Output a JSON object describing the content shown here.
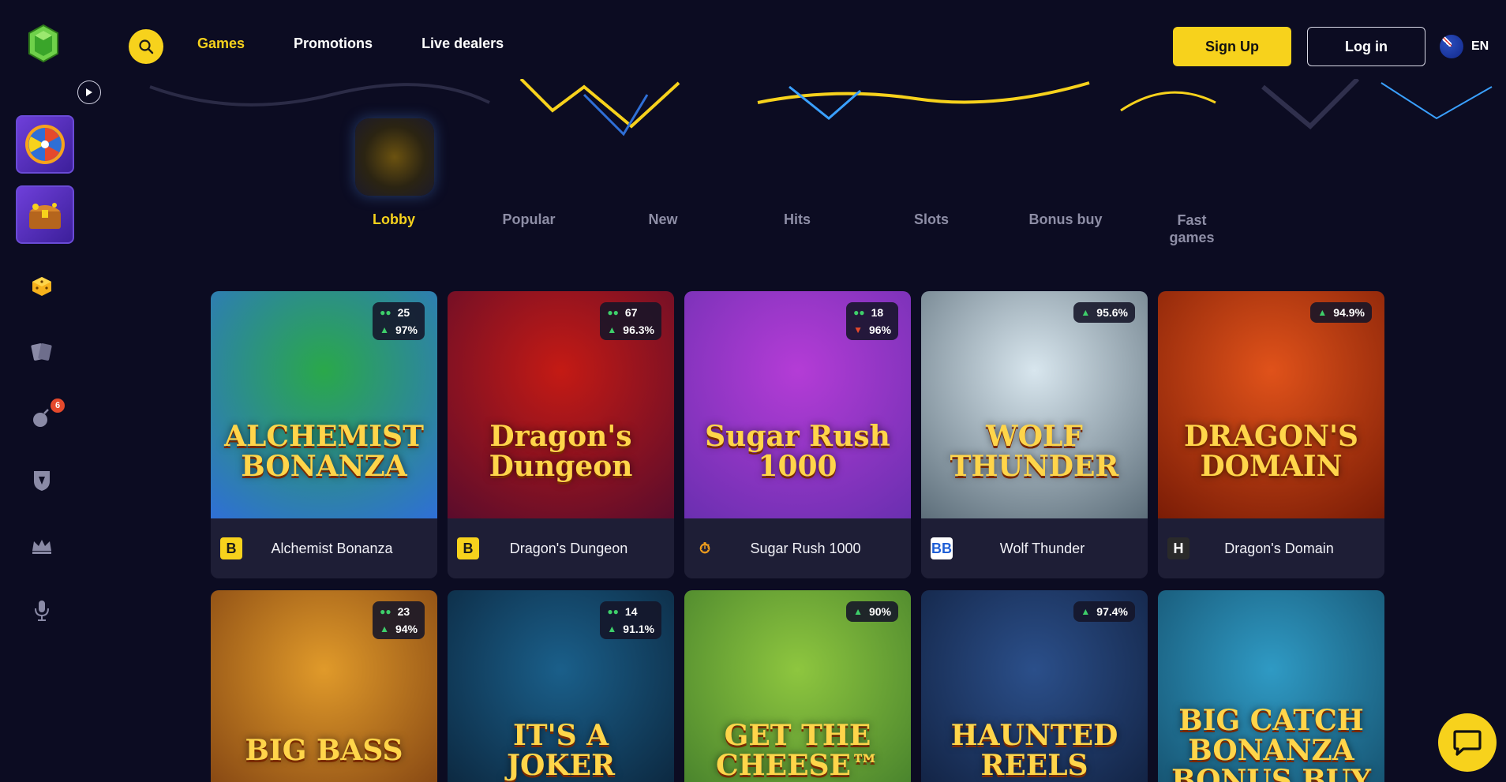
{
  "header": {
    "nav": [
      {
        "label": "Games",
        "active": true
      },
      {
        "label": "Promotions",
        "active": false
      },
      {
        "label": "Live dealers",
        "active": false
      }
    ],
    "signup_label": "Sign Up",
    "login_label": "Log in",
    "language": "EN"
  },
  "sidebar": {
    "items": [
      {
        "icon": "wheel-of-fortune-icon"
      },
      {
        "icon": "treasure-chest-icon"
      },
      {
        "icon": "dice-icon"
      },
      {
        "icon": "cards-icon"
      },
      {
        "icon": "bomb-icon",
        "badge": "6"
      },
      {
        "icon": "shield-icon"
      },
      {
        "icon": "crown-icon"
      },
      {
        "icon": "microphone-icon"
      }
    ]
  },
  "categories": [
    {
      "label": "Lobby",
      "active": true
    },
    {
      "label": "Popular"
    },
    {
      "label": "New"
    },
    {
      "label": "Hits"
    },
    {
      "label": "Slots"
    },
    {
      "label": "Bonus buy"
    },
    {
      "label": "Fast games"
    }
  ],
  "games": [
    {
      "name": "Alchemist Bonanza",
      "art_title": "ALCHEMIST BONANZA",
      "provider": "B",
      "players": "25",
      "rtp": "97%",
      "rtp_dir": "up",
      "colors": [
        "#2aa84a",
        "#2f6fd6"
      ]
    },
    {
      "name": "Dragon's Dungeon",
      "art_title": "Dragon's Dungeon",
      "provider": "B",
      "players": "67",
      "rtp": "96.3%",
      "rtp_dir": "up",
      "colors": [
        "#c41a14",
        "#5a0c2c"
      ]
    },
    {
      "name": "Sugar Rush 1000",
      "art_title": "Sugar Rush 1000",
      "provider": "⏱",
      "players": "18",
      "rtp": "96%",
      "rtp_dir": "down",
      "colors": [
        "#b43cd6",
        "#6a2fb0"
      ]
    },
    {
      "name": "Wolf Thunder",
      "art_title": "WOLF THUNDER",
      "provider": "BB",
      "players": "",
      "rtp": "95.6%",
      "rtp_dir": "up",
      "colors": [
        "#d8e6ee",
        "#5d6e7a"
      ]
    },
    {
      "name": "Dragon's Domain",
      "art_title": "DRAGON'S DOMAIN",
      "provider": "H",
      "players": "",
      "rtp": "94.9%",
      "rtp_dir": "up",
      "colors": [
        "#e0521a",
        "#7a1c06"
      ]
    },
    {
      "name": "Big Bass",
      "art_title": "BIG BASS",
      "provider": "",
      "players": "23",
      "rtp": "94%",
      "rtp_dir": "up",
      "colors": [
        "#e09a2a",
        "#7a3c10"
      ]
    },
    {
      "name": "It's a Joker",
      "art_title": "IT'S A JOKER",
      "provider": "",
      "players": "14",
      "rtp": "91.1%",
      "rtp_dir": "up",
      "colors": [
        "#1a5f8a",
        "#0a2035"
      ]
    },
    {
      "name": "Get The Cheese",
      "art_title": "GET THE CHEESE™",
      "provider": "",
      "players": "",
      "rtp": "90%",
      "rtp_dir": "up",
      "colors": [
        "#8ec63f",
        "#3f7a2a"
      ]
    },
    {
      "name": "Haunted Reels",
      "art_title": "HAUNTED REELS",
      "provider": "",
      "players": "",
      "rtp": "97.4%",
      "rtp_dir": "up",
      "colors": [
        "#2b4f8a",
        "#0f1d3a"
      ]
    },
    {
      "name": "Big Catch Bonanza Bonus Buy",
      "art_title": "BIG CATCH BONANZA BONUS BUY",
      "provider": "",
      "players": "",
      "rtp": "",
      "rtp_dir": "up",
      "colors": [
        "#2f9ac4",
        "#134a66"
      ]
    }
  ]
}
